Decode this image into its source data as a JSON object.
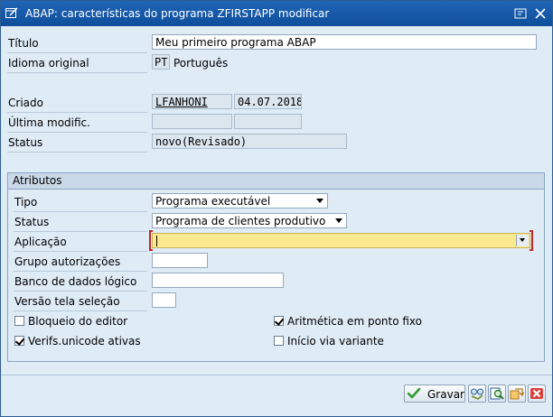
{
  "window": {
    "title": "ABAP: características do programa ZFIRSTAPP modificar"
  },
  "header": {
    "titulo": {
      "label": "Título",
      "value": "Meu primeiro programa ABAP"
    },
    "idioma": {
      "label": "Idioma original",
      "code": "PT",
      "name": "Português"
    },
    "criado": {
      "label": "Criado",
      "user": "LFANHONI",
      "date": "04.07.2018"
    },
    "ultima": {
      "label": "Última modific.",
      "user": "",
      "date": ""
    },
    "status": {
      "label": "Status",
      "value": "novo(Revisado)"
    }
  },
  "atributos": {
    "title": "Atributos",
    "tipo": {
      "label": "Tipo",
      "value": "Programa executável"
    },
    "status": {
      "label": "Status",
      "value": "Programa de clientes produtivo"
    },
    "aplicacao": {
      "label": "Aplicação",
      "value": ""
    },
    "grupo": {
      "label": "Grupo autorizações",
      "value": ""
    },
    "banco": {
      "label": "Banco de dados lógico",
      "value": ""
    },
    "versao": {
      "label": "Versão tela seleção",
      "value": ""
    },
    "checkboxes": {
      "bloqueio": {
        "label": "Bloqueio do editor",
        "checked": false
      },
      "aritmetica": {
        "label": "Aritmética em ponto fixo",
        "checked": true
      },
      "unicode": {
        "label": "Verifs.unicode ativas",
        "checked": true
      },
      "inicio": {
        "label": "Início via variante",
        "checked": false
      }
    }
  },
  "footer": {
    "save_label": "Gravar"
  },
  "colors": {
    "titlebar": "#1f64b5",
    "background": "#dfebf5",
    "required": "#fbe98f",
    "close": "#c9302c"
  },
  "icons": [
    "edit-window-icon",
    "help-icon",
    "close-window-icon",
    "checkmark-icon",
    "glasses-icon",
    "find-icon",
    "transfer-icon",
    "cancel-icon",
    "dropdown-icon"
  ]
}
